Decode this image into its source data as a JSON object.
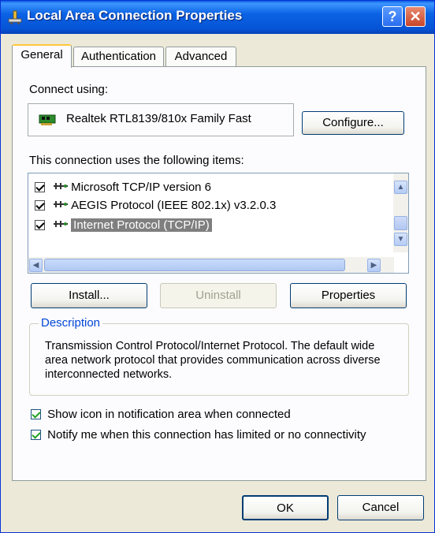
{
  "window": {
    "title": "Local Area Connection Properties",
    "help_label": "?",
    "close_label": "✕"
  },
  "tabs": [
    {
      "label": "General",
      "active": true
    },
    {
      "label": "Authentication",
      "active": false
    },
    {
      "label": "Advanced",
      "active": false
    }
  ],
  "general": {
    "connect_using_label": "Connect using:",
    "adapter_name": "Realtek RTL8139/810x Family Fast",
    "configure_label": "Configure...",
    "items_label": "This connection uses the following items:",
    "items": [
      {
        "label": "Microsoft TCP/IP version 6",
        "checked": true,
        "selected": false
      },
      {
        "label": "AEGIS Protocol (IEEE 802.1x) v3.2.0.3",
        "checked": true,
        "selected": false
      },
      {
        "label": "Internet Protocol (TCP/IP)",
        "checked": true,
        "selected": true
      }
    ],
    "install_label": "Install...",
    "uninstall_label": "Uninstall",
    "properties_label": "Properties",
    "description_title": "Description",
    "description_text": "Transmission Control Protocol/Internet Protocol. The default wide area network protocol that provides communication across diverse interconnected networks.",
    "show_icon_label": "Show icon in notification area when connected",
    "show_icon_checked": true,
    "notify_label": "Notify me when this connection has limited or no connectivity",
    "notify_checked": true
  },
  "footer": {
    "ok_label": "OK",
    "cancel_label": "Cancel"
  },
  "icons": {
    "title": "network-connection-icon",
    "adapter": "network-card-icon",
    "protocol": "network-protocol-icon"
  },
  "colors": {
    "titlebar": "#0b62e4",
    "selection": "#316ac5",
    "selection_inactive": "#b7b7b7",
    "group_title": "#0046d5"
  }
}
